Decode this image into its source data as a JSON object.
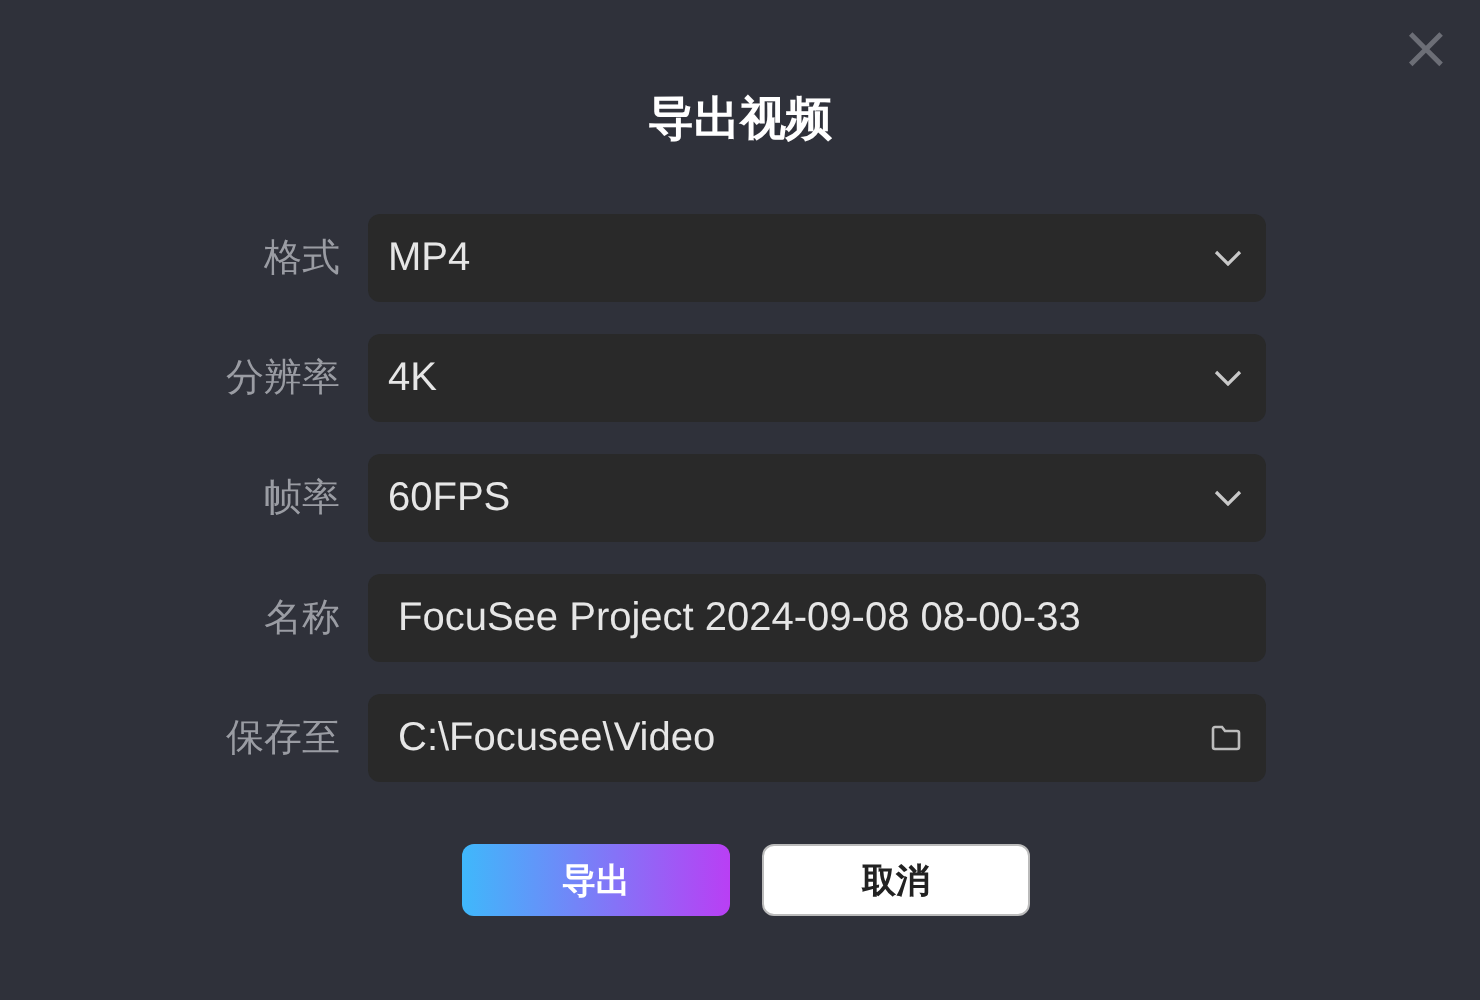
{
  "dialog": {
    "title": "导出视频",
    "close": "×"
  },
  "fields": [
    {
      "label": "格式",
      "kind": "select",
      "value": "MP4"
    },
    {
      "label": "分辨率",
      "kind": "select",
      "value": "4K"
    },
    {
      "label": "帧率",
      "kind": "select",
      "value": "60FPS"
    },
    {
      "label": "名称",
      "kind": "text",
      "value": "FocuSee Project 2024-09-08 08-00-33"
    },
    {
      "label": "保存至",
      "kind": "path",
      "value": "C:\\Focusee\\Video"
    }
  ],
  "buttons": [
    {
      "label": "导出",
      "kind": "primary"
    },
    {
      "label": "取消",
      "kind": "secondary"
    }
  ]
}
